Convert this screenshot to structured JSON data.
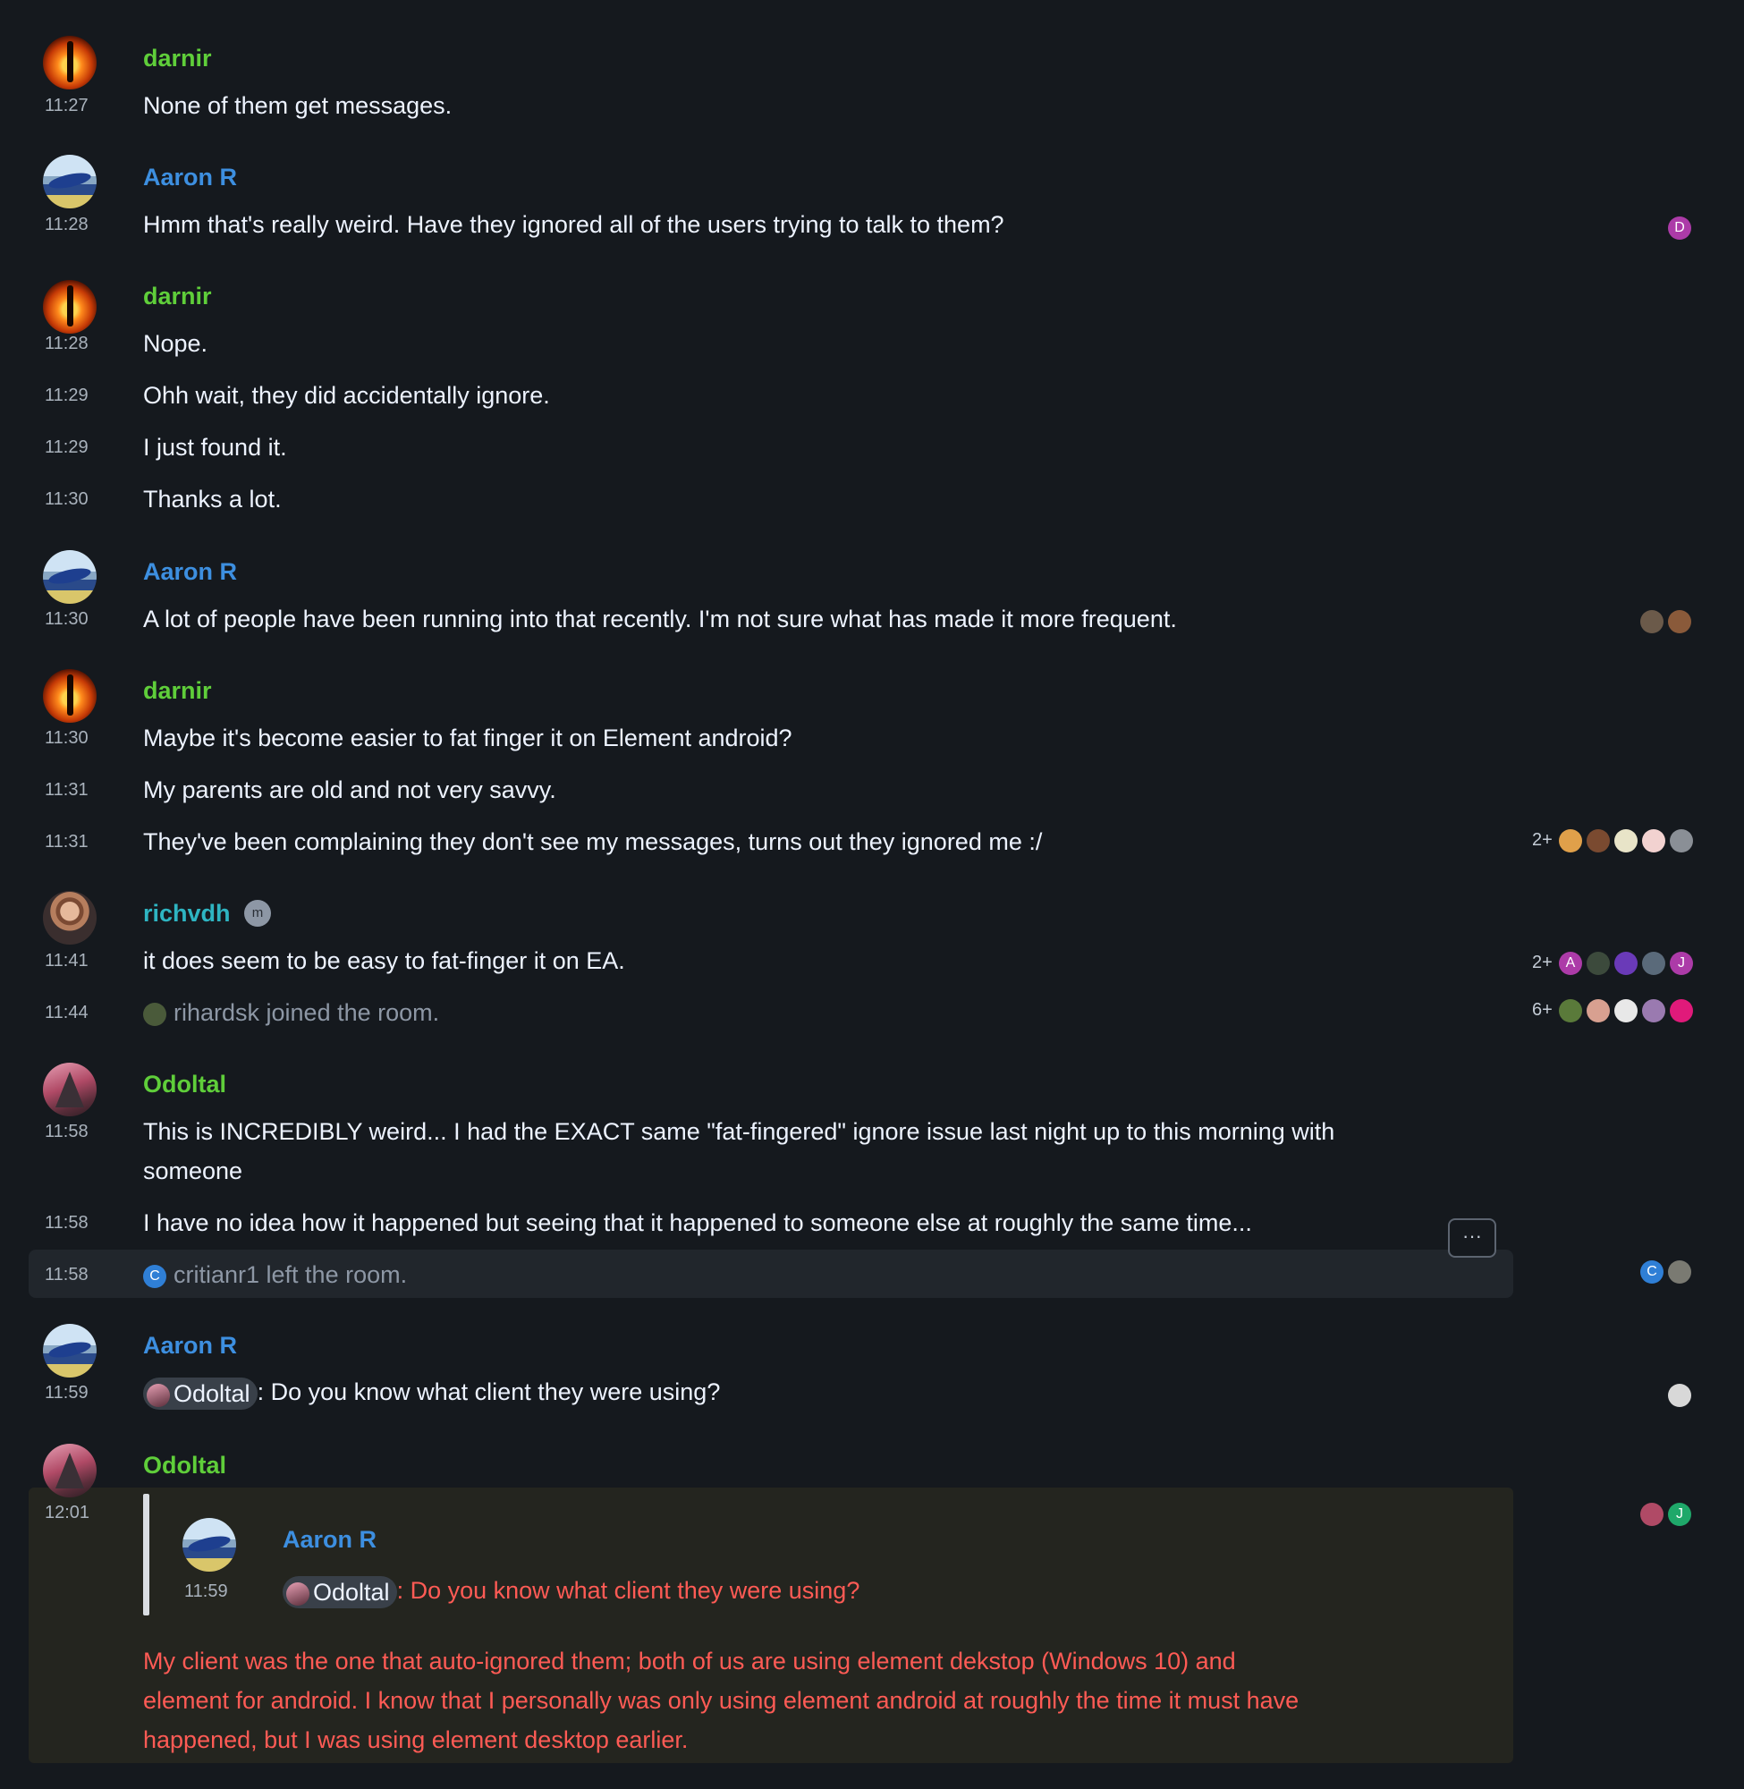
{
  "colors": {
    "background": "#15191e",
    "sender_green": "#5fce3a",
    "sender_blue": "#3d8fe0",
    "sender_teal": "#2eb5c2",
    "highlight_text": "#ff5b55"
  },
  "messages": {
    "m1": {
      "sender": "darnir",
      "time": "11:27",
      "text": "None of them get messages."
    },
    "m2": {
      "sender": "Aaron R",
      "time": "11:28",
      "text": "Hmm that's really weird. Have they ignored all of the users trying to talk to them?",
      "receipt_initial": "D"
    },
    "m3": {
      "sender": "darnir",
      "time": "11:28",
      "text": "Nope."
    },
    "m4": {
      "time": "11:29",
      "text": "Ohh wait, they did accidentally ignore."
    },
    "m5": {
      "time": "11:29",
      "text": "I just found it."
    },
    "m6": {
      "time": "11:30",
      "text": "Thanks a lot."
    },
    "m7": {
      "sender": "Aaron R",
      "time": "11:30",
      "text": "A lot of people have been running into that recently. I'm not sure what has made it more frequent."
    },
    "m8": {
      "sender": "darnir",
      "time": "11:30",
      "text": "Maybe it's become easier to fat finger it on Element android?"
    },
    "m9": {
      "time": "11:31",
      "text": "My parents are old and not very savvy."
    },
    "m10": {
      "time": "11:31",
      "text": "They've been complaining they don't see my messages, turns out they ignored me :/",
      "receipt_overflow": "2+"
    },
    "m11": {
      "sender": "richvdh",
      "badge": "m",
      "time": "11:41",
      "text": "it does seem to be easy to fat-finger it on EA.",
      "receipt_overflow": "2+",
      "receipt_initials": [
        "A",
        "J"
      ]
    },
    "m12": {
      "time": "11:44",
      "text": "rihardsk joined the room.",
      "receipt_overflow": "6+"
    },
    "m13": {
      "sender": "Odoltal",
      "time": "11:58",
      "text_line1": "This is INCREDIBLY weird... I had the EXACT same \"fat-fingered\" ignore issue last night up to this morning with",
      "text_line2": "someone"
    },
    "m14": {
      "time": "11:58",
      "text": "I have no idea how it happened but seeing that it happened to someone else at roughly the same time..."
    },
    "m15": {
      "time": "11:58",
      "text": "critianr1 left the room.",
      "avatar_initial": "C",
      "receipt_initial": "C",
      "options": "···"
    },
    "m16": {
      "sender": "Aaron R",
      "time": "11:59",
      "mention": "Odoltal",
      "text": ": Do you know what client they were using?"
    },
    "m17": {
      "sender": "Odoltal",
      "time": "12:01",
      "receipt_initial": "J",
      "quote": {
        "sender": "Aaron R",
        "time": "11:59",
        "mention": "Odoltal",
        "text": ": Do you know what client they were using?"
      },
      "line1": "My client was the one that auto-ignored them; both of us are using element dekstop (Windows 10) and",
      "line2": "element for android. I know that I personally was only using element android at roughly the time it must have",
      "line3": "happened, but I was using element desktop earlier."
    }
  }
}
